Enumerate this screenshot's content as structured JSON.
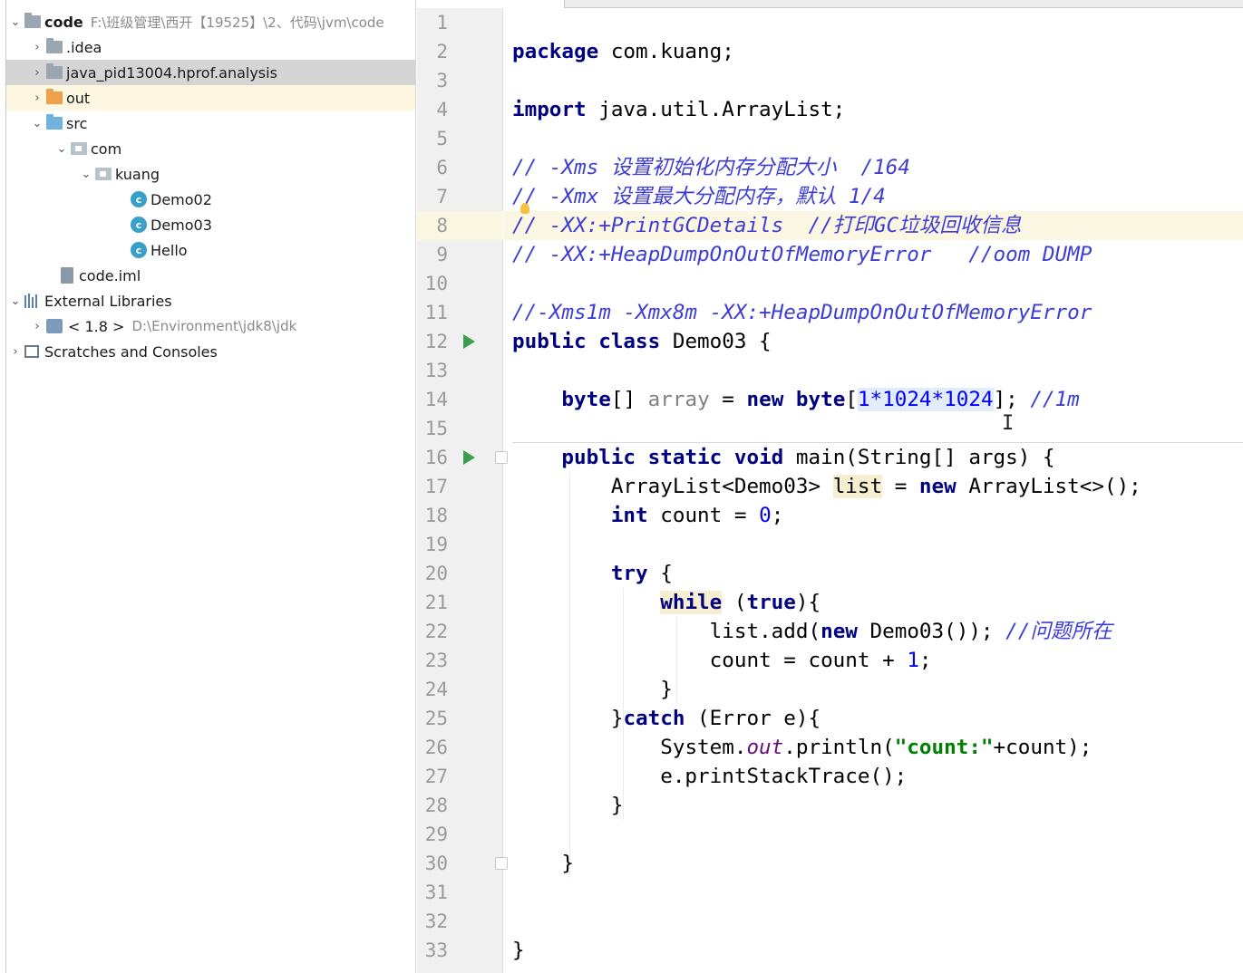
{
  "project_tree": {
    "root_name": "code",
    "root_path": "F:\\班级管理\\西开【19525】\\2、代码\\jvm\\code",
    "idea": ".idea",
    "analysis": "java_pid13004.hprof.analysis",
    "out": "out",
    "src": "src",
    "com": "com",
    "kuang": "kuang",
    "class_icon_letter": "c",
    "demo02": "Demo02",
    "demo03": "Demo03",
    "hello": "Hello",
    "code_iml": "code.iml",
    "external_libraries": "External Libraries",
    "jdk_version": "< 1.8 >",
    "jdk_path": "D:\\Environment\\jdk8\\jdk",
    "scratches": "Scratches and Consoles"
  },
  "editor": {
    "line_numbers": [
      "1",
      "2",
      "3",
      "4",
      "5",
      "6",
      "7",
      "8",
      "9",
      "10",
      "11",
      "12",
      "13",
      "14",
      "15",
      "16",
      "17",
      "18",
      "19",
      "20",
      "21",
      "22",
      "23",
      "24",
      "25",
      "26",
      "27",
      "28",
      "29",
      "30",
      "31",
      "32",
      "33"
    ],
    "code": {
      "l2_kw": "package",
      "l2_rest": " com.kuang;",
      "l4_kw": "import",
      "l4_rest": " java.util.ArrayList;",
      "l6": "// -Xms 设置初始化内存分配大小  /164",
      "l7": "// -Xmx 设置最大分配内存，默认 1/4",
      "l8": "// -XX:+PrintGCDetails  //打印GC垃圾回收信息",
      "l9": "// -XX:+HeapDumpOnOutOfMemoryError   //oom DUMP",
      "l11": "//-Xms1m -Xmx8m -XX:+HeapDumpOnOutOfMemoryError",
      "l12_kw": "public class",
      "l12_rest": " Demo03 {",
      "l14_indent": "    ",
      "l14_type": "byte",
      "l14_a": "[] ",
      "l14_var": "array",
      "l14_b": " = ",
      "l14_new": "new",
      "l14_type2": " byte",
      "l14_c": "[",
      "l14_expr": "1*1024*1024",
      "l14_d": "]; ",
      "l14_cm": "//1m",
      "l16_indent": "    ",
      "l16_kw": "public static void",
      "l16_rest": " main(String[] args) {",
      "l17_indent": "        ",
      "l17_a": "ArrayList<Demo03> ",
      "l17_var": "list",
      "l17_b": " = ",
      "l17_new": "new",
      "l17_c": " ArrayList<>();",
      "l18_indent": "        ",
      "l18_kw": "int",
      "l18_a": " count = ",
      "l18_num": "0",
      "l18_b": ";",
      "l20_indent": "        ",
      "l20_kw": "try",
      "l20_a": " {",
      "l21_indent": "            ",
      "l21_kw": "while",
      "l21_a": " (",
      "l21_true": "true",
      "l21_b": "){",
      "l22_indent": "                ",
      "l22_a": "list.add(",
      "l22_new": "new",
      "l22_b": " Demo03()); ",
      "l22_cm": "//问题所在",
      "l23_indent": "                ",
      "l23_a": "count = count + ",
      "l23_num": "1",
      "l23_b": ";",
      "l24": "            }",
      "l25_indent": "        ",
      "l25_a": "}",
      "l25_kw": "catch",
      "l25_b": " (Error e){",
      "l26_indent": "            ",
      "l26_a": "System.",
      "l26_fld": "out",
      "l26_b": ".println(",
      "l26_str": "\"count:\"",
      "l26_c": "+count);",
      "l27": "            e.printStackTrace();",
      "l28": "        }",
      "l30": "    }",
      "l33": "}"
    }
  }
}
